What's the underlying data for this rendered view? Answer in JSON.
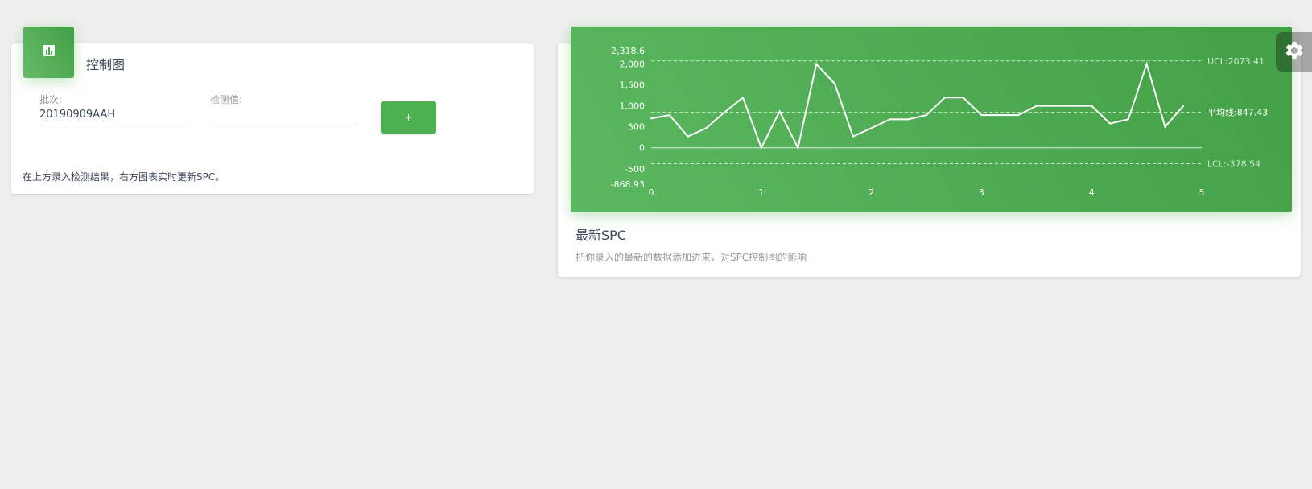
{
  "left_card": {
    "title": "控制图",
    "icon": "bar-chart-icon",
    "batch_label": "批次:",
    "batch_value": "20190909AAH",
    "measure_label": "检测值:",
    "measure_value": "",
    "add_button_label": "+",
    "description": "在上方录入检测结果，右方图表实时更新SPC。"
  },
  "right_card": {
    "title": "最新SPC",
    "subtitle": "把你录入的最新的数据添加进来，对SPC控制图的影响"
  },
  "settings": {
    "icon": "gear-icon"
  },
  "colors": {
    "accent": "#4caf50",
    "card_bg": "#ffffff",
    "page_bg": "#eeeeee"
  },
  "chart_data": {
    "type": "line",
    "title": "",
    "xlabel": "",
    "ylabel": "",
    "x_ticks": [
      0,
      1,
      2,
      3,
      4,
      5
    ],
    "y_ticks": [
      "2,318.6",
      "2,000",
      "1,500",
      "1,000",
      "500",
      "0",
      "-500",
      "-868.93"
    ],
    "y_min": -868.93,
    "y_max": 2318.6,
    "x_min": 0,
    "x_max": 5,
    "grid": false,
    "series": [
      {
        "x": [
          0,
          0.167,
          0.333,
          0.5,
          0.667,
          0.833,
          1.0,
          1.167,
          1.333,
          1.5,
          1.667,
          1.833,
          2.0,
          2.167,
          2.333,
          2.5,
          2.667,
          2.833,
          3.0,
          3.167,
          3.333,
          3.5,
          3.667,
          3.833,
          4.0,
          4.167,
          4.333,
          4.5,
          4.667,
          4.833
        ],
        "values": [
          700,
          780,
          270,
          470,
          850,
          1200,
          0,
          870,
          0,
          2000,
          1530,
          270,
          470,
          680,
          680,
          780,
          1200,
          1200,
          780,
          780,
          780,
          1000,
          1000,
          1000,
          1000,
          580,
          680,
          2000,
          500,
          1000
        ]
      }
    ],
    "reference_lines": [
      {
        "label": "UCL:2073.41",
        "value": 2073.41,
        "style": "dashed"
      },
      {
        "label": "平均线:847.43",
        "value": 847.43,
        "style": "dashed"
      },
      {
        "label": "LCL:-378.54",
        "value": -378.54,
        "style": "dashed"
      }
    ]
  }
}
